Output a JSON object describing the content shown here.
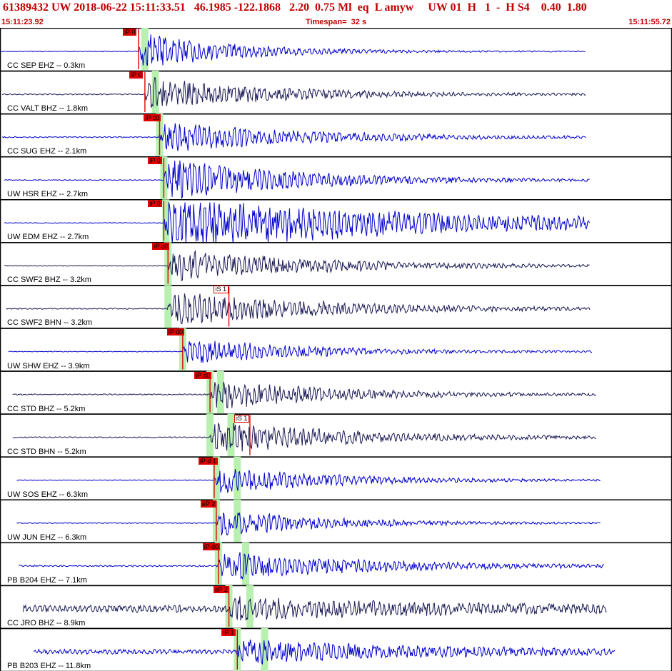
{
  "header": {
    "line": "61389432 UW 2018-06-22 15:11:33.51   46.1985 -122.1868   2.20  0.75 Ml  eq  L amyw     UW 01  H   1  -  H S4    0.40  1.80",
    "time_start": "15:11:23.92",
    "timespan": "Timespan=  32 s",
    "time_end": "15:11:55.72"
  },
  "colors": {
    "header_text": "#c00000",
    "trace_blue": "#0000cc",
    "trace_dark": "#1a1a55",
    "pick_red": "#e00000",
    "window_green": "#b8f0b0",
    "panel_border": "#000000"
  },
  "traces": [
    {
      "label": "CC SEP EHZ -- 0.3km",
      "picks": [
        {
          "label": "iP 0",
          "time": 6.6,
          "kind": "P"
        }
      ],
      "p_window": 6.9,
      "s_window": null,
      "color": "blue",
      "start": 0.0,
      "end": 27.9,
      "noise": 0.02,
      "amp": 1.0,
      "decay": 4.5
    },
    {
      "label": "CC VALT BHZ -- 1.8km",
      "picks": [
        {
          "label": "iP 0",
          "time": 6.9,
          "kind": "P"
        }
      ],
      "p_window": 7.4,
      "s_window": null,
      "color": "dark",
      "start": 0.1,
      "end": 27.9,
      "noise": 0.03,
      "amp": 0.9,
      "decay": 6.0
    },
    {
      "label": "CC SUG EHZ -- 2.1km",
      "picks": [
        {
          "label": "iP c0",
          "time": 7.6,
          "kind": "P"
        }
      ],
      "p_window": 7.6,
      "s_window": null,
      "color": "blue",
      "start": 0.1,
      "end": 27.9,
      "noise": 0.03,
      "amp": 0.8,
      "decay": 7.0
    },
    {
      "label": "UW HSR EHZ -- 2.7km",
      "picks": [
        {
          "label": "iP 0",
          "time": 7.8,
          "kind": "P"
        }
      ],
      "p_window": 7.8,
      "s_window": null,
      "color": "blue",
      "start": 0.2,
      "end": 28.1,
      "noise": 0.02,
      "amp": 1.1,
      "decay": 6.5
    },
    {
      "label": "UW EDM EHZ -- 2.7km",
      "picks": [
        {
          "label": "iP 0",
          "time": 7.8,
          "kind": "P"
        }
      ],
      "p_window": 7.9,
      "s_window": null,
      "color": "blue",
      "start": 0.2,
      "end": 28.1,
      "noise": 0.02,
      "amp": 1.4,
      "decay": 14.0
    },
    {
      "label": "CC SWF2 BHZ -- 3.2km",
      "picks": [
        {
          "label": "iP c0",
          "time": 8.0,
          "kind": "P"
        }
      ],
      "p_window": 8.0,
      "s_window": null,
      "color": "dark",
      "start": 0.2,
      "end": 28.1,
      "noise": 0.02,
      "amp": 0.9,
      "decay": 7.0
    },
    {
      "label": "CC SWF2 BHN -- 3.2km",
      "picks": [
        {
          "label": "iS 1",
          "time": 10.9,
          "kind": "S"
        }
      ],
      "p_window": 8.0,
      "s_window": null,
      "color": "dark",
      "start": 0.3,
      "end": 28.1,
      "noise": 0.03,
      "amp": 0.9,
      "decay": 7.5
    },
    {
      "label": "UW SHW EHZ -- 3.9km",
      "picks": [
        {
          "label": "iP d0",
          "time": 8.7,
          "kind": "P"
        }
      ],
      "p_window": 8.7,
      "s_window": null,
      "color": "blue",
      "start": 0.4,
      "end": 28.2,
      "noise": 0.02,
      "amp": 0.7,
      "decay": 6.0
    },
    {
      "label": "CC STD BHZ -- 5.2km",
      "picks": [
        {
          "label": "iP d0",
          "time": 10.0,
          "kind": "P"
        }
      ],
      "p_window": 10.0,
      "s_window": 10.5,
      "color": "dark",
      "start": 0.6,
      "end": 28.4,
      "noise": 0.03,
      "amp": 0.8,
      "decay": 6.0
    },
    {
      "label": "CC STD BHN -- 5.2km",
      "picks": [
        {
          "label": "iS 1",
          "time": 11.9,
          "kind": "S"
        }
      ],
      "p_window": 10.0,
      "s_window": 11.0,
      "color": "dark",
      "start": 0.6,
      "end": 28.4,
      "noise": 0.03,
      "amp": 0.9,
      "decay": 6.5
    },
    {
      "label": "UW SOS EHZ -- 6.3km",
      "picks": [
        {
          "label": "iP d 1",
          "time": 10.2,
          "kind": "P"
        }
      ],
      "p_window": 10.3,
      "s_window": 11.3,
      "color": "blue",
      "start": 0.8,
      "end": 28.6,
      "noise": 0.02,
      "amp": 0.7,
      "decay": 6.0
    },
    {
      "label": "UW JUN EHZ -- 6.3km",
      "picks": [
        {
          "label": "eP 2",
          "time": 10.3,
          "kind": "P"
        }
      ],
      "p_window": 10.3,
      "s_window": 11.3,
      "color": "blue",
      "start": 0.8,
      "end": 28.6,
      "noise": 0.02,
      "amp": 0.7,
      "decay": 5.5
    },
    {
      "label": "PB B204 EHZ -- 7.1km",
      "picks": [
        {
          "label": "iP d0",
          "time": 10.4,
          "kind": "P"
        }
      ],
      "p_window": 10.4,
      "s_window": 11.7,
      "color": "blue",
      "start": 0.9,
      "end": 28.8,
      "noise": 0.04,
      "amp": 0.8,
      "decay": 7.0
    },
    {
      "label": "CC JRO BHZ -- 8.9km",
      "picks": [
        {
          "label": "eP 2",
          "time": 10.9,
          "kind": "P"
        }
      ],
      "p_window": 10.9,
      "s_window": 11.9,
      "color": "dark",
      "start": 1.1,
      "end": 28.9,
      "noise": 0.18,
      "amp": 0.5,
      "decay": 9.0
    },
    {
      "label": "PB B203 EHZ -- 11.8km",
      "picks": [
        {
          "label": "iP 1",
          "time": 11.3,
          "kind": "P"
        }
      ],
      "p_window": 11.3,
      "s_window": 12.6,
      "color": "blue",
      "start": 1.6,
      "end": 29.3,
      "noise": 0.12,
      "amp": 0.6,
      "decay": 8.0
    }
  ]
}
